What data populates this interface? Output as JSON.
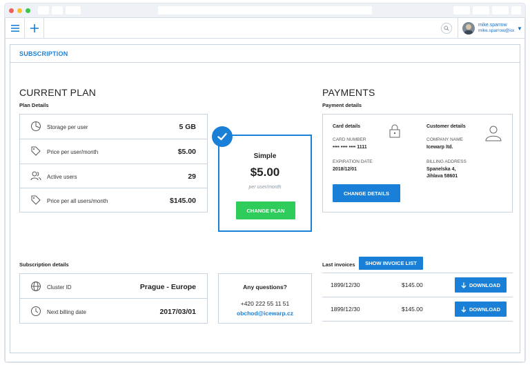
{
  "user": {
    "name": "mike.sparrow",
    "email": "mike.sparrow@icewarp.com"
  },
  "section_title": "SUBSCRIPTION",
  "current_plan": {
    "heading": "CURRENT PLAN",
    "details_label": "Plan Details",
    "rows": [
      {
        "label": "Storage per user",
        "value": "5 GB"
      },
      {
        "label": "Price per user/month",
        "value": "$5.00"
      },
      {
        "label": "Active users",
        "value": "29"
      },
      {
        "label": "Price per all users/month",
        "value": "$145.00"
      }
    ],
    "card": {
      "name": "Simple",
      "price": "$5.00",
      "per": "per user/month",
      "button": "CHANGE PLAN"
    }
  },
  "payments": {
    "heading": "PAYMENTS",
    "details_label": "Payment details",
    "card_details_label": "Card details",
    "card_number_key": "CARD NUMBER",
    "card_number": "•••• •••• •••• 1111",
    "expiration_key": "EXPIRATION DATE",
    "expiration": "2018/12/01",
    "customer_details_label": "Customer details",
    "company_key": "COMPANY NAME",
    "company": "Icewarp ltd.",
    "billing_key": "BILLING ADDRESS",
    "billing_line1": "Spanelska 4,",
    "billing_line2": "Jihlava 58601",
    "button": "CHANGE DETAILS"
  },
  "subscription_details": {
    "label": "Subscription details",
    "rows": [
      {
        "label": "Cluster ID",
        "value": "Prague - Europe"
      },
      {
        "label": "Next billing date",
        "value": "2017/03/01"
      }
    ]
  },
  "questions": {
    "title": "Any questions?",
    "phone": "+420 222 55 11 51",
    "email": "obchod@icewarp.cz"
  },
  "invoices": {
    "label": "Last invoices",
    "list_button": "SHOW INVOICE LIST",
    "download_label": "DOWNLOAD",
    "rows": [
      {
        "date": "1899/12/30",
        "amount": "$145.00"
      },
      {
        "date": "1899/12/30",
        "amount": "$145.00"
      }
    ]
  },
  "colors": {
    "accent": "#1a7fd6",
    "green": "#2ecc5a",
    "border": "#c7d2dd"
  }
}
